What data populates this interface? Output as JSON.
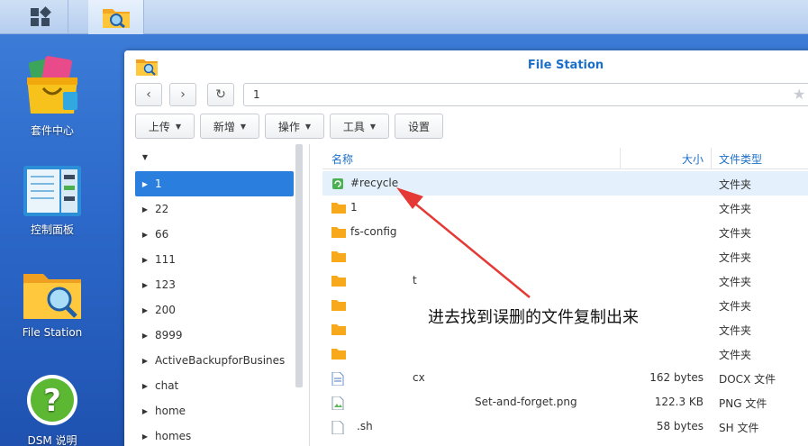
{
  "desktop_icons": [
    {
      "label": "套件中心",
      "icon": "package-center-icon"
    },
    {
      "label": "控制面板",
      "icon": "control-panel-icon"
    },
    {
      "label": "File Station",
      "icon": "file-station-icon"
    },
    {
      "label": "DSM 说明",
      "icon": "help-icon"
    }
  ],
  "window": {
    "title": "File Station",
    "path": "1",
    "toolbar": {
      "upload": "上传",
      "new": "新增",
      "action": "操作",
      "tools": "工具",
      "settings": "设置"
    },
    "tree": {
      "selected": "1",
      "items": [
        "1",
        "22",
        "66",
        "111",
        "123",
        "200",
        "8999",
        "ActiveBackupforBusines",
        "chat",
        "home",
        "homes"
      ]
    },
    "columns": {
      "name": "名称",
      "size": "大小",
      "type": "文件类型"
    },
    "files": [
      {
        "name": "#recycle",
        "size": "",
        "type": "文件夹",
        "icon": "recycle-folder-icon"
      },
      {
        "name": "1",
        "size": "",
        "type": "文件夹",
        "icon": "folder-icon"
      },
      {
        "name": "fs-config",
        "size": "",
        "type": "文件夹",
        "icon": "folder-icon"
      },
      {
        "name": "",
        "size": "",
        "type": "文件夹",
        "icon": "folder-icon"
      },
      {
        "name": "t",
        "size": "",
        "type": "文件夹",
        "icon": "folder-icon"
      },
      {
        "name": "",
        "size": "",
        "type": "文件夹",
        "icon": "folder-icon"
      },
      {
        "name": "",
        "size": "",
        "type": "文件夹",
        "icon": "folder-icon"
      },
      {
        "name": "",
        "size": "",
        "type": "文件夹",
        "icon": "folder-icon"
      },
      {
        "name": "cx",
        "size": "162 bytes",
        "type": "DOCX 文件",
        "icon": "docx-file-icon"
      },
      {
        "name": "Set-and-forget.png",
        "size": "122.3 KB",
        "type": "PNG 文件",
        "icon": "png-file-icon"
      },
      {
        "name": ".sh",
        "size": "58 bytes",
        "type": "SH 文件",
        "icon": "sh-file-icon"
      }
    ]
  },
  "annotation": "进去找到误删的文件复制出来",
  "colors": {
    "accent": "#2a7fde",
    "title": "#1c6fc8",
    "arrow": "#e53935"
  }
}
